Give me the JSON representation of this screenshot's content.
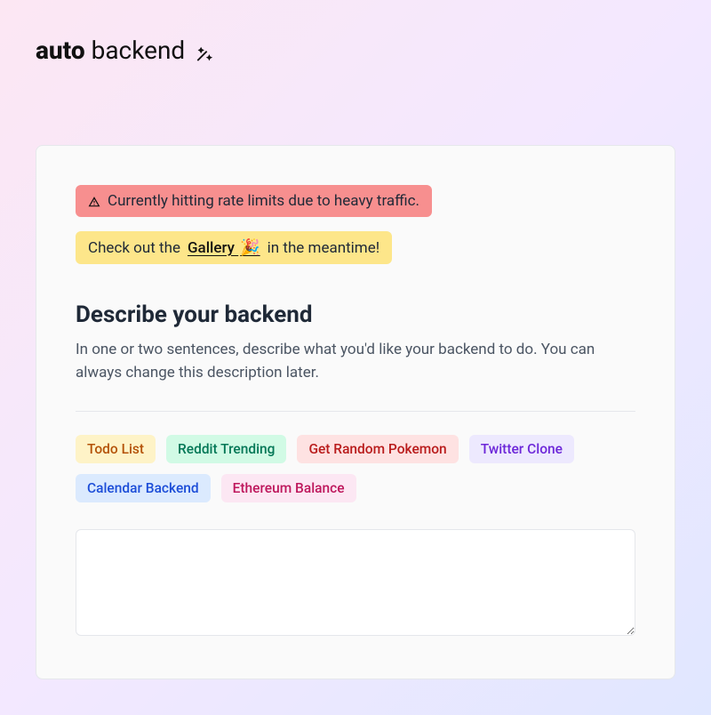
{
  "logo": {
    "bold": "auto",
    "light": "backend"
  },
  "alerts": {
    "rate_limit": "Currently hitting rate limits due to heavy traffic.",
    "gallery_prefix": "Check out the ",
    "gallery_link": "Gallery",
    "gallery_suffix": " in the meantime!"
  },
  "main": {
    "heading": "Describe your backend",
    "subtext": "In one or two sentences, describe what you'd like your backend to do. You can always change this description later."
  },
  "chips": [
    {
      "label": "Todo List",
      "variant": "orange"
    },
    {
      "label": "Reddit Trending",
      "variant": "green"
    },
    {
      "label": "Get Random Pokemon",
      "variant": "red"
    },
    {
      "label": "Twitter Clone",
      "variant": "purple"
    },
    {
      "label": "Calendar Backend",
      "variant": "blue"
    },
    {
      "label": "Ethereum Balance",
      "variant": "rose"
    }
  ],
  "textarea": {
    "placeholder": ""
  }
}
